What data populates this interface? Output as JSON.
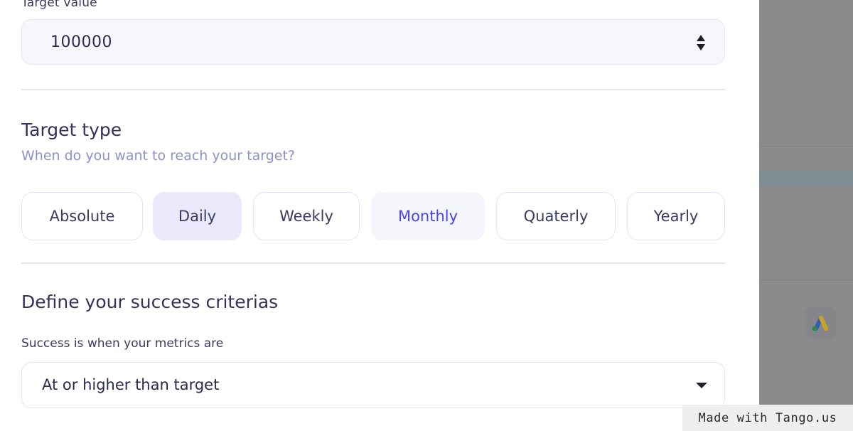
{
  "target_value": {
    "label": "Target value",
    "value": "100000"
  },
  "target_type": {
    "title": "Target type",
    "subtitle": "When do you want to reach your target?",
    "options": [
      "Absolute",
      "Daily",
      "Weekly",
      "Monthly",
      "Quaterly",
      "Yearly"
    ],
    "selected": "Daily",
    "hovered": "Monthly"
  },
  "success": {
    "title": "Define your success criterias",
    "label": "Success is when your metrics are",
    "selected_value": "At or higher than target"
  },
  "background_app": {
    "icon": "google-ads-icon"
  },
  "watermark": {
    "text": "Made with Tango.us"
  },
  "colors": {
    "accent": "#4a44e6",
    "selected_bg": "#ebe8fc",
    "overlay": "#8b8b8b"
  }
}
